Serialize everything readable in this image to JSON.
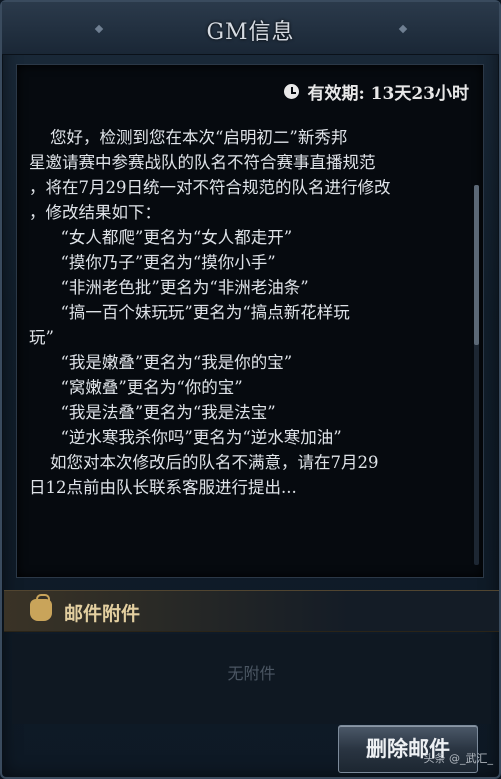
{
  "window": {
    "title": "GM信息"
  },
  "mail": {
    "validity_label": "有效期: 13天23小时",
    "body_lines": [
      "    您好，检测到您在本次“启明初二”新秀邦",
      "星邀请赛中参赛战队的队名不符合赛事直播规范",
      "，将在7月29日统一对不符合规范的队名进行修改",
      "，修改结果如下：",
      "      “女人都爬”更名为“女人都走开”",
      "      “摸你乃子”更名为“摸你小手”",
      "      “非洲老色批”更名为“非洲老油条”",
      "      “搞一百个妹玩玩”更名为“搞点新花样玩",
      "玩”",
      "      “我是嫩叠”更名为“我是你的宝”",
      "      “窝嫩叠”更名为“你的宝”",
      "      “我是法叠”更名为“我是法宝”",
      "      “逆水寒我杀你吗”更名为“逆水寒加油”",
      "    如您对本次修改后的队名不满意，请在7月29",
      "日12点前由队长联系客服进行提出..."
    ]
  },
  "attachments": {
    "header_label": "邮件附件",
    "empty_text": "无附件"
  },
  "actions": {
    "delete_label": "删除邮件"
  },
  "watermark": "头条 @_武汇_"
}
